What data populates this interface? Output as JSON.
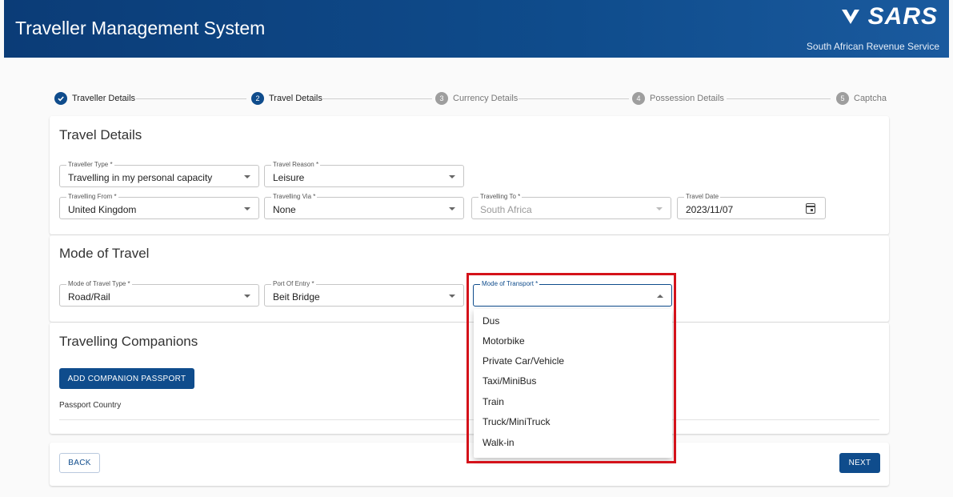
{
  "header": {
    "title": "Traveller Management System",
    "logo_text": "SARS",
    "logo_subtitle": "South African Revenue Service"
  },
  "stepper": [
    {
      "index": "✓",
      "label": "Traveller Details",
      "state": "done"
    },
    {
      "index": "2",
      "label": "Travel Details",
      "state": "active"
    },
    {
      "index": "3",
      "label": "Currency Details",
      "state": "pending"
    },
    {
      "index": "4",
      "label": "Possession Details",
      "state": "pending"
    },
    {
      "index": "5",
      "label": "Captcha",
      "state": "pending"
    }
  ],
  "travel_details": {
    "title": "Travel Details",
    "traveller_type": {
      "label": "Traveller Type *",
      "value": "Travelling in my personal capacity"
    },
    "travel_reason": {
      "label": "Travel Reason *",
      "value": "Leisure"
    },
    "travelling_from": {
      "label": "Travelling From *",
      "value": "United Kingdom"
    },
    "travelling_via": {
      "label": "Travelling Via *",
      "value": "None"
    },
    "travelling_to": {
      "label": "Travelling To *",
      "value": "South Africa"
    },
    "travel_date": {
      "label": "Travel Date",
      "value": "2023/11/07"
    }
  },
  "mode_of_travel": {
    "title": "Mode of Travel",
    "mode_type": {
      "label": "Mode of Travel Type *",
      "value": "Road/Rail"
    },
    "port_of_entry": {
      "label": "Port Of Entry *",
      "value": "Beit Bridge"
    },
    "mode_of_transport": {
      "label": "Mode of Transport *",
      "value": ""
    }
  },
  "companions": {
    "title": "Travelling Companions",
    "add_button": "ADD COMPANION PASSPORT",
    "column_header": "Passport Country"
  },
  "transport_options": [
    "Dus",
    "Motorbike",
    "Private Car/Vehicle",
    "Taxi/MiniBus",
    "Train",
    "Truck/MiniTruck",
    "Walk-in"
  ],
  "footer": {
    "back_label": "BACK",
    "next_label": "NEXT"
  },
  "colors": {
    "primary": "#0f4c8c",
    "header_bg": "#0b3c77",
    "highlight": "#d4121a"
  }
}
